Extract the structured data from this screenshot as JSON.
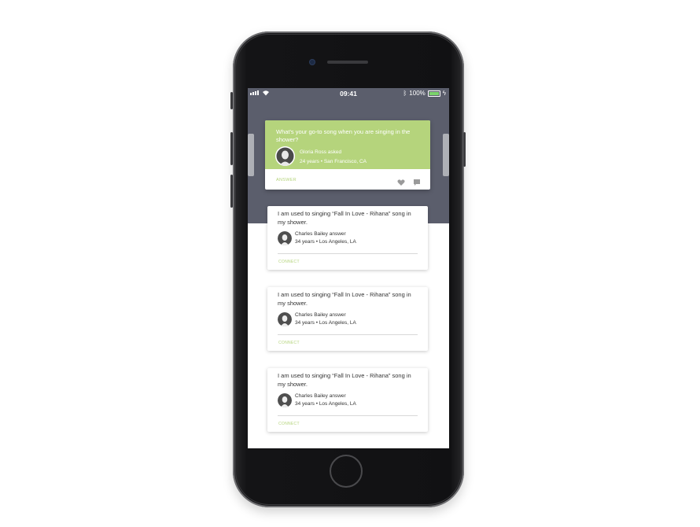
{
  "status_bar": {
    "time": "09:41",
    "battery": "100%",
    "icons": [
      "signal-icon",
      "wifi-icon",
      "bluetooth-icon",
      "battery-icon",
      "charging-icon"
    ]
  },
  "question": {
    "text": "What's your go-to song when you are singing in the shower?",
    "author": "Gloria Ross asked",
    "details": "24 years • San Francisco, CA",
    "answer_label": "ANSWER"
  },
  "answers": [
    {
      "text": "I am used to singing “Fall In Love - Rihana” song in my shower.",
      "author": "Charles Bailey answer",
      "details": "34 years • Los Angeles, LA",
      "connect_label": "CONNECT"
    },
    {
      "text": "I am used to singing “Fall In Love - Rihana” song in my shower.",
      "author": "Charles Bailey answer",
      "details": "34 years • Los Angeles, LA",
      "connect_label": "CONNECT"
    },
    {
      "text": "I am used to singing “Fall In Love - Rihana” song in my shower.",
      "author": "Charles Bailey answer",
      "details": "34 years • Los Angeles, LA",
      "connect_label": "CONNECT"
    }
  ],
  "colors": {
    "accent": "#b5d47c",
    "header_bg": "#5b5e6c"
  }
}
